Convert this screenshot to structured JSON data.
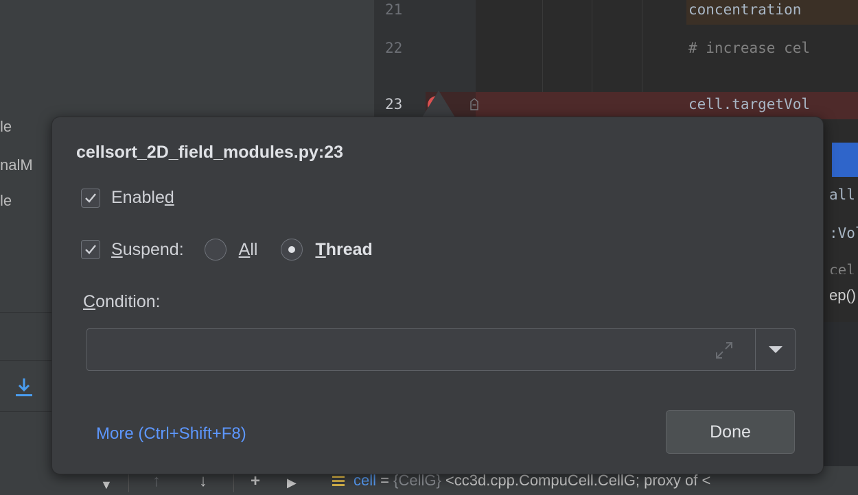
{
  "project_panel": {
    "fragments": [
      "le",
      "nalM",
      "le"
    ]
  },
  "editor": {
    "lines": [
      {
        "number": "21",
        "code": "concentration"
      },
      {
        "number": "22",
        "code": "# increase cel"
      },
      {
        "number": "23",
        "code": "cell.targetVol"
      }
    ],
    "right_fragments": [
      "all",
      ":Vol",
      "cel",
      "ep()"
    ]
  },
  "popup": {
    "title": "cellsort_2D_field_modules.py:23",
    "enabled": {
      "checked": true,
      "label_pre": "Enable",
      "label_mnemonic": "d",
      "label_post": ""
    },
    "suspend": {
      "checked": true,
      "label_mnemonic": "S",
      "label_post": "uspend:"
    },
    "radio_all": {
      "selected": false,
      "label_mnemonic": "A",
      "label_post": "ll"
    },
    "radio_thread": {
      "selected": true,
      "label_mnemonic": "T",
      "label_post": "hread"
    },
    "condition": {
      "label_mnemonic": "C",
      "label_post": "ondition:",
      "value": ""
    },
    "more_link": "More (Ctrl+Shift+F8)",
    "done_label": "Done"
  },
  "debug_toolbar": {
    "variable": {
      "name": "cell",
      "eq": " = ",
      "type": "{CellG}",
      "value": " <cc3d.cpp.CompuCell.CellG; proxy of <"
    }
  },
  "colors": {
    "breakpoint": "#dc5151",
    "link": "#5d97ff",
    "selection": "#2f65ca"
  }
}
